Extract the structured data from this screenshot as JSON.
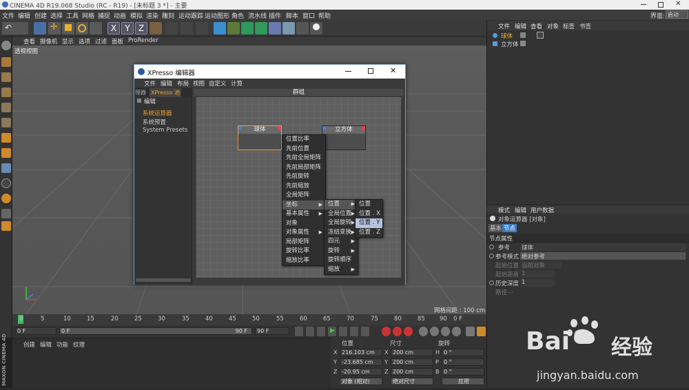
{
  "window_title": "CINEMA 4D R19.068 Studio (RC - R19) - [未标题 3 *] - 主要",
  "menubar": [
    "文件",
    "编辑",
    "创建",
    "选择",
    "工具",
    "网格",
    "捕捉",
    "动画",
    "模拟",
    "渲染",
    "雕刻",
    "运动跟踪",
    "运动图形",
    "角色",
    "流水线",
    "插件",
    "脚本",
    "窗口",
    "帮助"
  ],
  "layout_label": "界面:",
  "layout_value": "启动",
  "viewport_menu": [
    "查看",
    "摄像机",
    "显示",
    "选项",
    "过滤",
    "面板",
    "ProRender"
  ],
  "viewport_label": "透视视图",
  "grid_info": "网格间距 : 100 cm",
  "timeline": {
    "ticks": [
      "0",
      "5",
      "10",
      "15",
      "20",
      "25",
      "30",
      "35",
      "40",
      "45",
      "50",
      "55",
      "60",
      "65",
      "70",
      "75",
      "80",
      "85",
      "90"
    ],
    "end": "0 F"
  },
  "playbar": {
    "start": "0 F",
    "range_start": "0 F",
    "range_end": "90 F",
    "end": "90 F"
  },
  "material_menu": [
    "创建",
    "编辑",
    "功能",
    "纹理"
  ],
  "maxon_logo": "MAXON CINEMA 4D",
  "coords": {
    "headers": [
      "位置",
      "尺寸",
      "旋转"
    ],
    "rows": [
      {
        "pl": "X",
        "pv": "216.103 cm",
        "sl": "X",
        "sv": "200 cm",
        "rl": "H",
        "rv": "0 °"
      },
      {
        "pl": "Y",
        "pv": "-23.685 cm",
        "sl": "Y",
        "sv": "200 cm",
        "rl": "P",
        "rv": "0 °"
      },
      {
        "pl": "Z",
        "pv": "-20.95 cm",
        "sl": "Z",
        "sv": "200 cm",
        "rl": "B",
        "rv": "0 °"
      }
    ],
    "mode1": "对象 (相对)",
    "mode2": "绝对尺寸",
    "apply": "应用"
  },
  "object_manager": {
    "menu": [
      "文件",
      "编辑",
      "查看",
      "对象",
      "标签",
      "书签"
    ],
    "objects": [
      "球体",
      "立方体"
    ]
  },
  "attr_manager": {
    "menu": [
      "模式",
      "编辑",
      "用户数据"
    ],
    "title": "对象运算器 [对象]",
    "tabs": [
      "基本",
      "节点"
    ],
    "section": "节点属性",
    "rows": [
      {
        "label": "参考",
        "value": "球体"
      },
      {
        "label": "参考模式",
        "value": "绝对参考"
      },
      {
        "label": "起始位置",
        "value": "当前对象"
      },
      {
        "label": "起始距离",
        "value": "1"
      },
      {
        "label": "历史深度",
        "value": "1"
      },
      {
        "label": "路径",
        "value": "..."
      }
    ]
  },
  "xpresso": {
    "title": "XPresso 编辑器",
    "menu": [
      "文件",
      "编辑",
      "布局",
      "视图",
      "自定义",
      "计算"
    ],
    "tabs": [
      "理器",
      "XPresso 池"
    ],
    "left_menu": "编辑",
    "tree": [
      "系统运算器",
      "系统预置",
      "System Presets"
    ],
    "group": "群组",
    "nodes": [
      "球体",
      "立方体"
    ],
    "menu1": [
      "位置比率",
      "先前位置",
      "先前全局矩阵",
      "先前局部矩阵",
      "先前旋转",
      "先前缩放",
      "全局矩阵",
      "坐标",
      "基本属性",
      "对象",
      "对象属性",
      "局部矩阵",
      "旋转比率",
      "缩放比率"
    ],
    "menu2": [
      "位置",
      "全局位置",
      "全局旋转",
      "冻结变换",
      "四元",
      "旋转",
      "旋转顺序",
      "缩放"
    ],
    "menu3": [
      "位置",
      "位置 . X",
      "位置 . Y",
      "位置 . Z"
    ]
  },
  "watermark": {
    "brand": "Bai",
    "brand2": "经验",
    "url": "jingyan.baidu.com"
  }
}
